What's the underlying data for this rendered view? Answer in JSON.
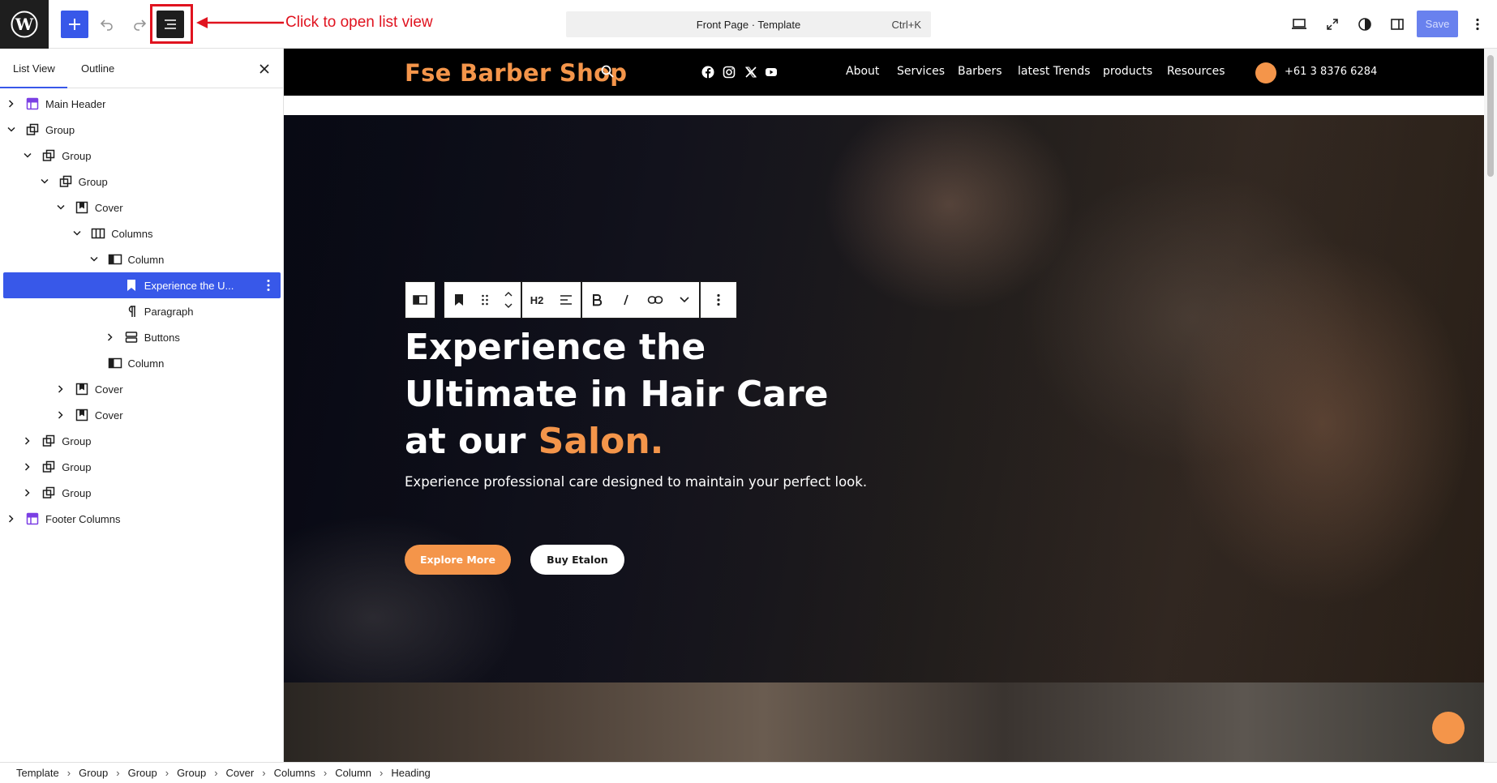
{
  "topbar": {
    "list_view_annotation": "Click to open list view",
    "document_title": "Front Page · Template",
    "shortcut": "Ctrl+K",
    "save_label": "Save"
  },
  "sidebar": {
    "tabs": [
      "List View",
      "Outline"
    ],
    "active_tab": "List View",
    "tree": [
      {
        "label": "Main Header",
        "icon": "template-part-icon",
        "level": 0,
        "expander": "collapsed"
      },
      {
        "label": "Group",
        "icon": "group-icon",
        "level": 0,
        "expander": "expanded"
      },
      {
        "label": "Group",
        "icon": "group-icon",
        "level": 1,
        "expander": "expanded"
      },
      {
        "label": "Group",
        "icon": "group-icon",
        "level": 2,
        "expander": "expanded"
      },
      {
        "label": "Cover",
        "icon": "cover-icon",
        "level": 3,
        "expander": "expanded"
      },
      {
        "label": "Columns",
        "icon": "columns-icon",
        "level": 4,
        "expander": "expanded"
      },
      {
        "label": "Column",
        "icon": "column-icon",
        "level": 5,
        "expander": "expanded"
      },
      {
        "label": "Experience the U...",
        "icon": "heading-bookmark-icon",
        "level": 6,
        "expander": "none",
        "selected": true
      },
      {
        "label": "Paragraph",
        "icon": "paragraph-icon",
        "level": 6,
        "expander": "none"
      },
      {
        "label": "Buttons",
        "icon": "buttons-icon",
        "level": 6,
        "expander": "collapsed"
      },
      {
        "label": "Column",
        "icon": "column-icon",
        "level": 5,
        "expander": "none"
      },
      {
        "label": "Cover",
        "icon": "cover-icon",
        "level": 3,
        "expander": "collapsed"
      },
      {
        "label": "Cover",
        "icon": "cover-icon",
        "level": 3,
        "expander": "collapsed"
      },
      {
        "label": "Group",
        "icon": "group-icon",
        "level": 1,
        "expander": "collapsed"
      },
      {
        "label": "Group",
        "icon": "group-icon",
        "level": 1,
        "expander": "collapsed"
      },
      {
        "label": "Group",
        "icon": "group-icon",
        "level": 1,
        "expander": "collapsed"
      },
      {
        "label": "Footer Columns",
        "icon": "template-part-icon",
        "level": 0,
        "expander": "collapsed"
      }
    ]
  },
  "site": {
    "title": "Fse Barber Shop",
    "nav": [
      "About",
      "Services",
      "Barbers",
      "latest Trends",
      "products",
      "Resources"
    ],
    "social": [
      "facebook-icon",
      "instagram-icon",
      "x-icon",
      "youtube-icon"
    ],
    "phone": "+61 3 8376 6284",
    "accent_color": "#f4954a"
  },
  "block_toolbar": {
    "heading_level": "H2"
  },
  "hero": {
    "heading_line1": "Experience the",
    "heading_line2": "Ultimate in Hair Care",
    "heading_line3_prefix": "at our",
    "heading_line3_accent": "Salon.",
    "subtitle": "Experience professional care designed to maintain your perfect look.",
    "primary_button": "Explore More",
    "secondary_button": "Buy Etalon"
  },
  "breadcrumbs": [
    "Template",
    "Group",
    "Group",
    "Group",
    "Cover",
    "Columns",
    "Column",
    "Heading"
  ]
}
